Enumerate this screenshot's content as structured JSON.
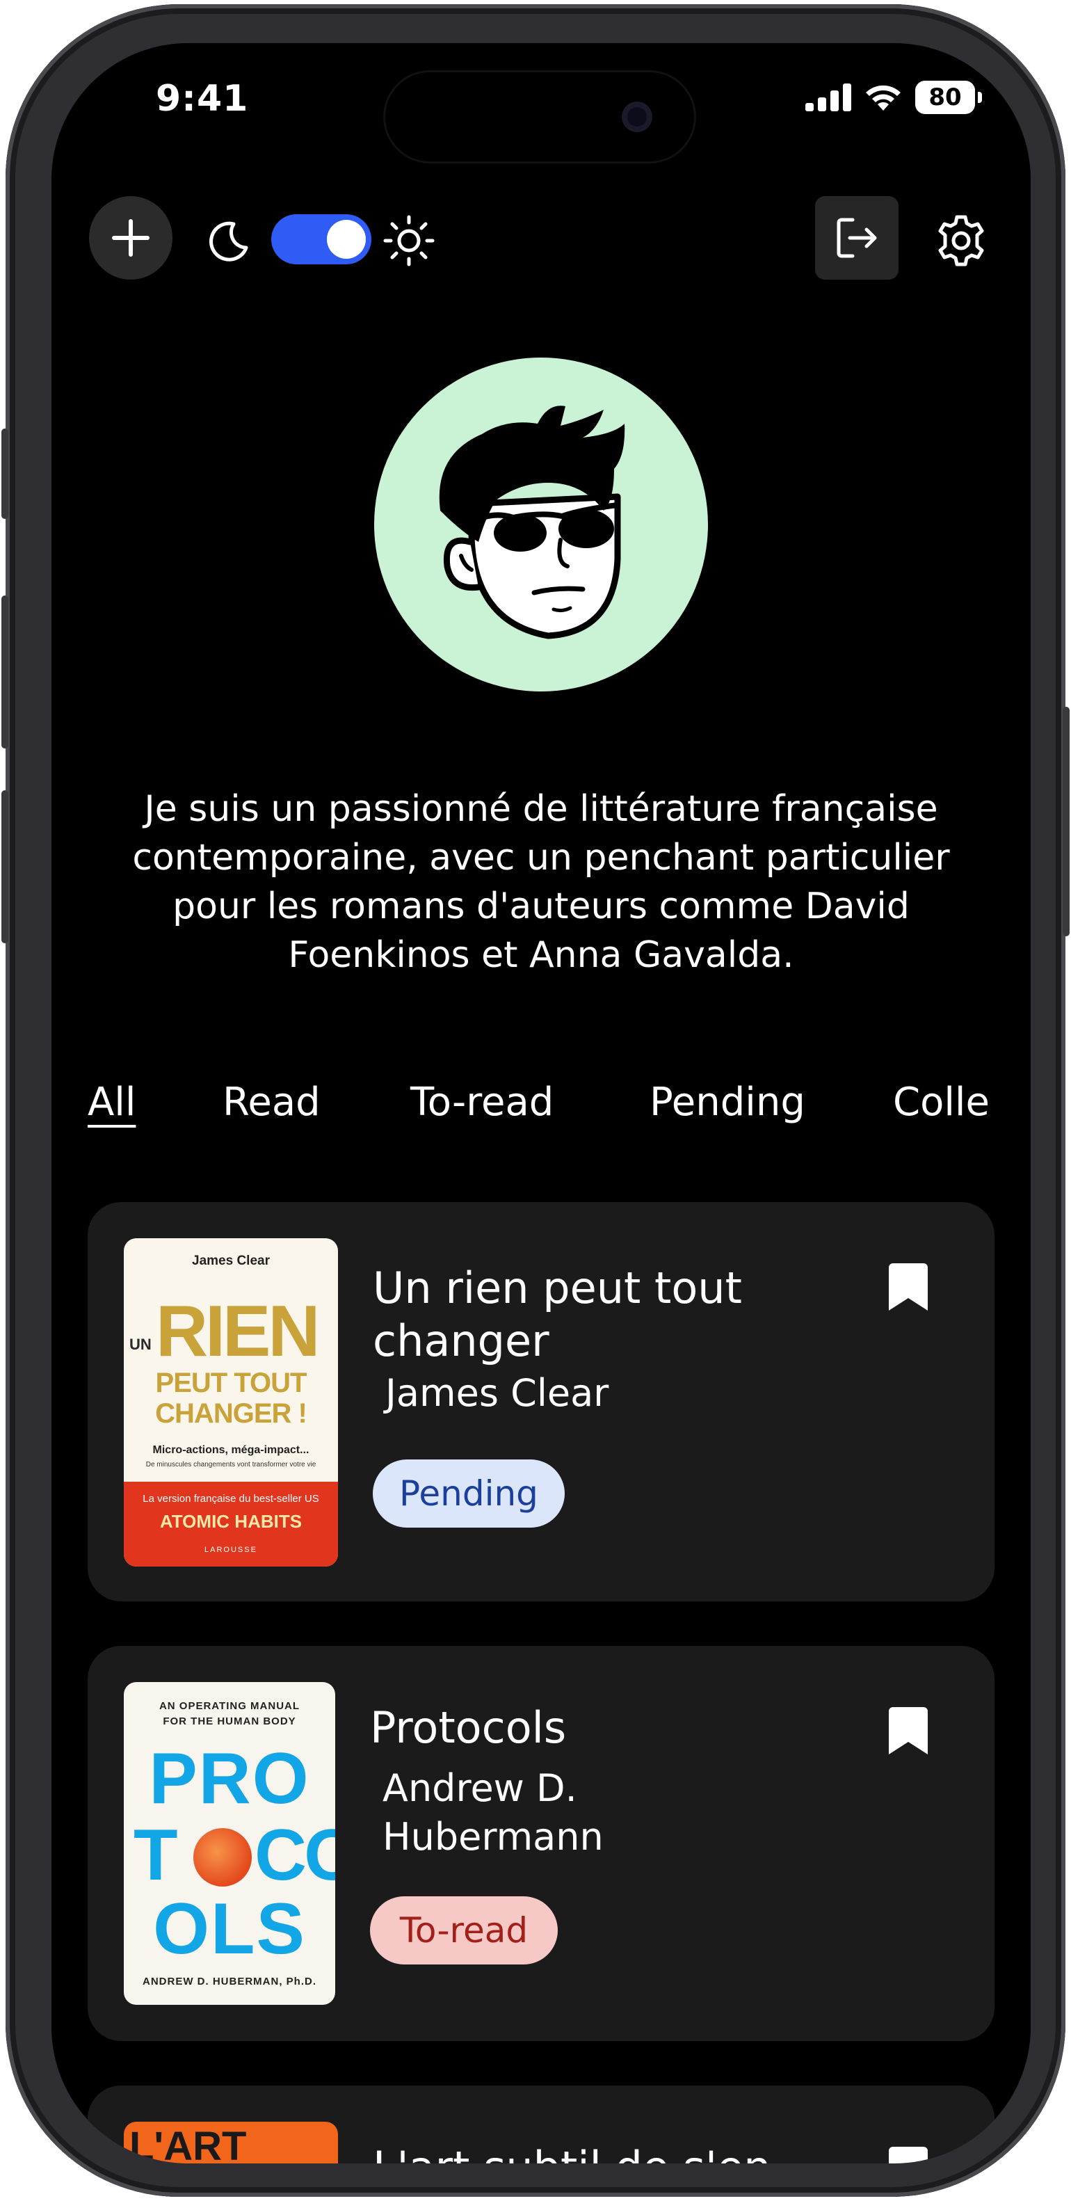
{
  "status_bar": {
    "time": "9:41",
    "battery": "80"
  },
  "toolbar": {
    "add_icon": "plus-icon",
    "theme_toggle_on": true,
    "logout_icon": "logout-icon",
    "settings_icon": "gear-icon"
  },
  "profile": {
    "bio": "Je suis un passionné de littérature française contemporaine, avec un penchant particulier pour les romans d'auteurs comme David Foenkinos et Anna Gavalda."
  },
  "tabs": [
    "All",
    "Read",
    "To-read",
    "Pending",
    "Colle"
  ],
  "books": [
    {
      "title": "Un rien peut tout changer",
      "author": "James Clear",
      "status": "Pending",
      "cover": {
        "author": "James Clear",
        "line1_small": "UN",
        "line1_big": "RIEN",
        "line2": "PEUT TOUT",
        "line3": "CHANGER !",
        "tagline": "Micro-actions, méga-impact...",
        "subtagline": "De minuscules changements vont transformer votre vie",
        "band_text": "La version française du best-seller US",
        "band_title": "ATOMIC HABITS",
        "publisher": "LAROUSSE"
      }
    },
    {
      "title": "Protocols",
      "author": "Andrew D. Hubermann",
      "status": "To-read",
      "cover": {
        "top_line1": "AN OPERATING MANUAL",
        "top_line2": "FOR THE HUMAN BODY",
        "row1": "PRO",
        "row2_left": "T",
        "row2_right": "CO",
        "row3": "OLS",
        "byline": "ANDREW D. HUBERMAN, Ph.D."
      }
    },
    {
      "title": "L'art subtil de s'en foutre",
      "cover": {
        "top_text": "L'ART"
      }
    }
  ],
  "colors": {
    "background": "#000000",
    "card": "#1b1b1b",
    "toggle": "#2f5cf5",
    "avatar_bg": "#c9f3d4",
    "pending_bg": "#dbe6fb",
    "pending_text": "#1c3f9c",
    "toread_bg": "#f7c9c6",
    "toread_text": "#a3201a"
  }
}
